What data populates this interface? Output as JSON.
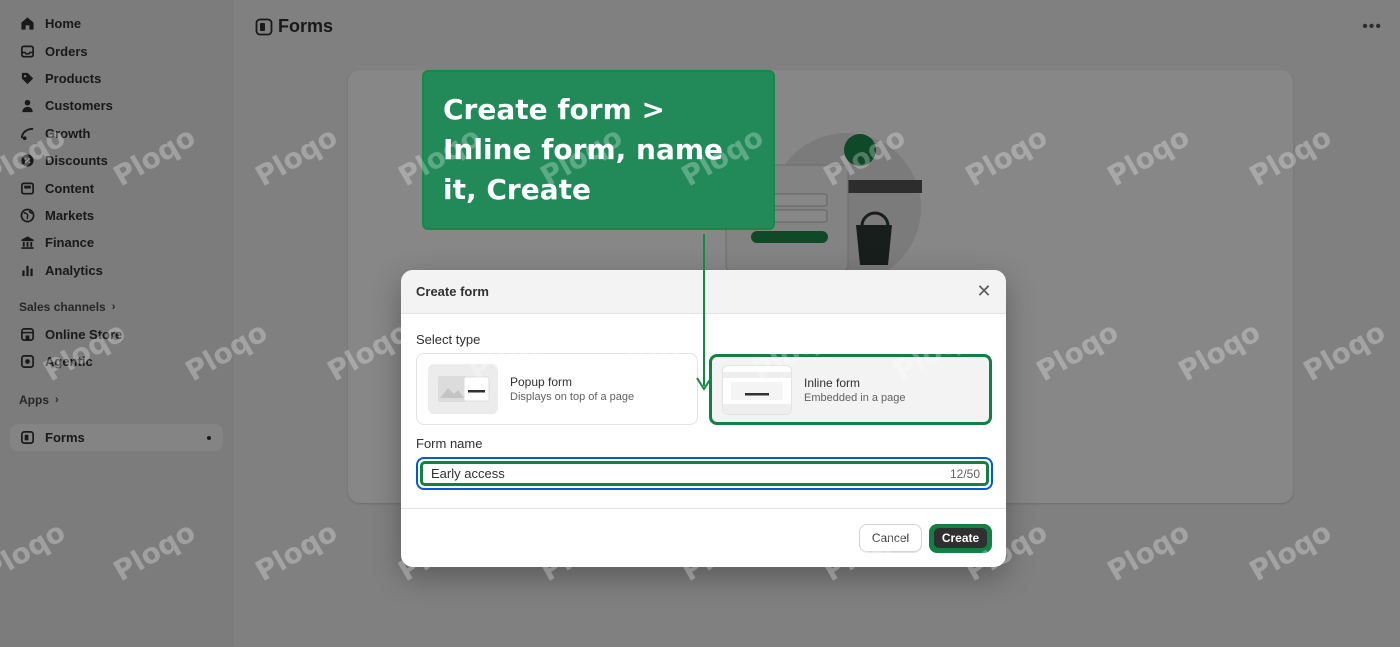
{
  "sidebar": {
    "items": [
      {
        "label": "Home",
        "icon": "home-icon"
      },
      {
        "label": "Orders",
        "icon": "inbox-icon"
      },
      {
        "label": "Products",
        "icon": "tag-icon"
      },
      {
        "label": "Customers",
        "icon": "person-icon"
      },
      {
        "label": "Growth",
        "icon": "growth-icon"
      },
      {
        "label": "Discounts",
        "icon": "discount-icon"
      },
      {
        "label": "Content",
        "icon": "content-icon"
      },
      {
        "label": "Markets",
        "icon": "globe-icon"
      },
      {
        "label": "Finance",
        "icon": "bank-icon"
      },
      {
        "label": "Analytics",
        "icon": "bar-chart-icon"
      }
    ],
    "sales_channels_label": "Sales channels",
    "channels": [
      {
        "label": "Online Store",
        "icon": "store-icon"
      },
      {
        "label": "Agentic",
        "icon": "agentic-icon"
      }
    ],
    "apps_label": "Apps",
    "active_app": {
      "label": "Forms",
      "icon": "forms-icon"
    }
  },
  "page": {
    "title": "Forms"
  },
  "modal": {
    "title": "Create form",
    "select_type_label": "Select type",
    "types": [
      {
        "title": "Popup form",
        "subtitle": "Displays on top of a page"
      },
      {
        "title": "Inline form",
        "subtitle": "Embedded in a page"
      }
    ],
    "selected_type": "Inline form",
    "form_name_label": "Form name",
    "form_name_value": "Early access",
    "char_count": "12/50",
    "cancel_label": "Cancel",
    "create_label": "Create"
  },
  "callout": {
    "text": "Create form > Inline form, name it, Create",
    "color": "#218a58"
  },
  "watermark": "Ploqo",
  "colors": {
    "focus_blue": "#005bd3",
    "highlight_green": "#108043",
    "primary_button": "#303030"
  }
}
